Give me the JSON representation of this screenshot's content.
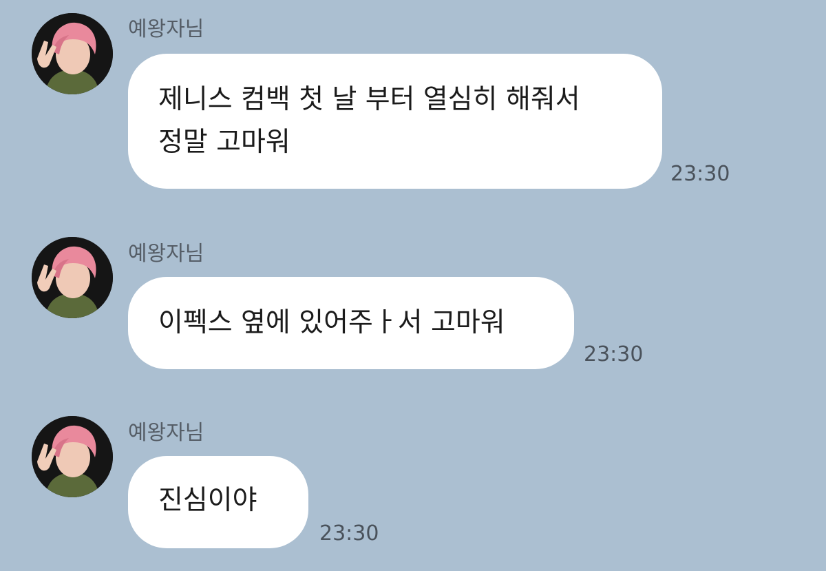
{
  "background_color": "#abbfd1",
  "bubble_color": "#ffffff",
  "messages": [
    {
      "sender": "예왕자님",
      "avatar_icon": "profile-avatar-icon",
      "text": "제니스 컴백 첫 날 부터 열심히 해줘서\n정말 고마워",
      "time": "23:30"
    },
    {
      "sender": "예왕자님",
      "avatar_icon": "profile-avatar-icon",
      "text": "이펙스 옆에 있어주ㅏ서 고마워",
      "time": "23:30"
    },
    {
      "sender": "예왕자님",
      "avatar_icon": "profile-avatar-icon",
      "text": "진심이야",
      "time": "23:30"
    }
  ]
}
